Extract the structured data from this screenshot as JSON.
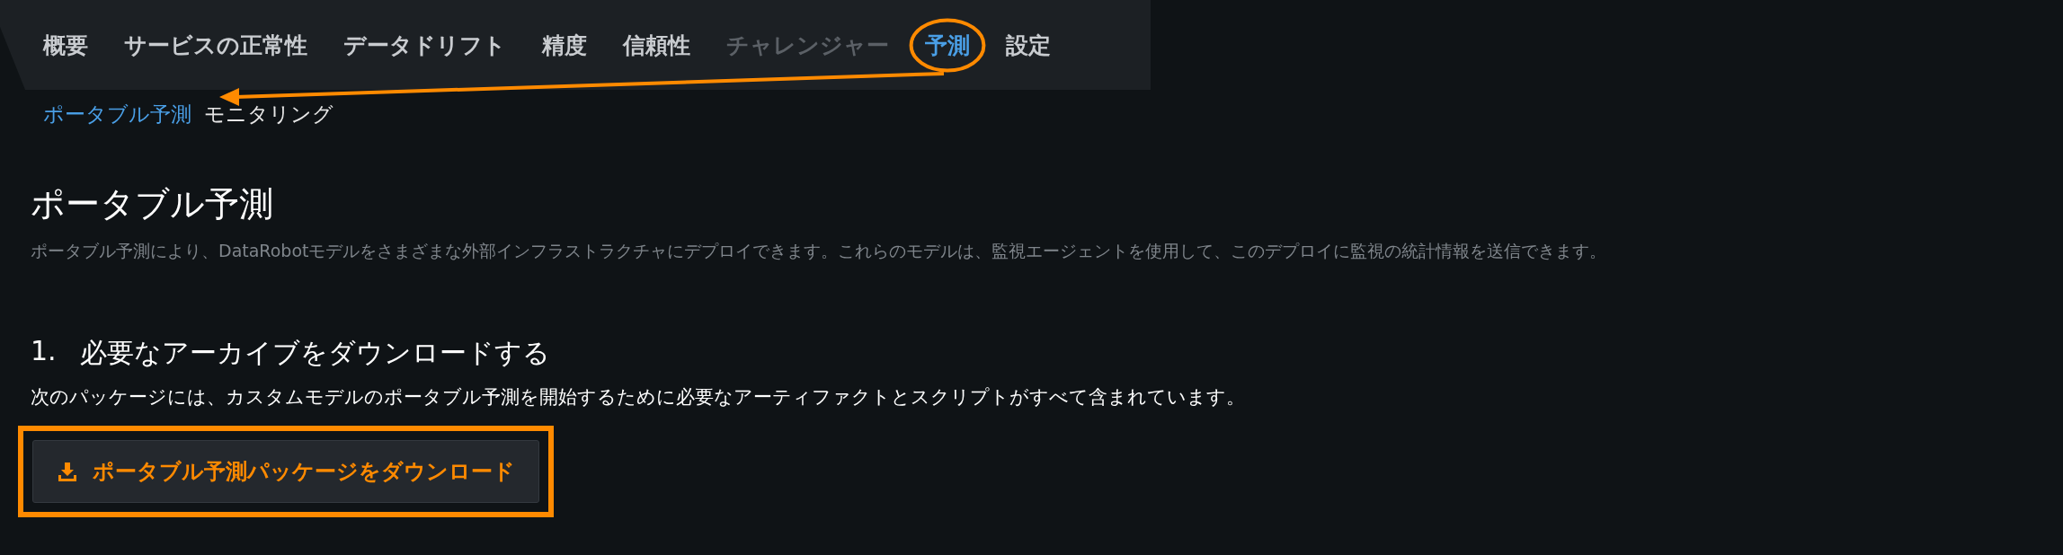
{
  "tabs": [
    {
      "label": "概要",
      "selected": false,
      "disabled": false
    },
    {
      "label": "サービスの正常性",
      "selected": false,
      "disabled": false
    },
    {
      "label": "データドリフト",
      "selected": false,
      "disabled": false
    },
    {
      "label": "精度",
      "selected": false,
      "disabled": false
    },
    {
      "label": "信頼性",
      "selected": false,
      "disabled": false
    },
    {
      "label": "チャレンジャー",
      "selected": false,
      "disabled": true
    },
    {
      "label": "予測",
      "selected": true,
      "disabled": false
    },
    {
      "label": "設定",
      "selected": false,
      "disabled": false
    }
  ],
  "subtabs": [
    {
      "label": "ポータブル予測",
      "selected": true
    },
    {
      "label": "モニタリング",
      "selected": false
    }
  ],
  "section": {
    "title": "ポータブル予測",
    "description": "ポータブル予測により、DataRobotモデルをさまざまな外部インフラストラクチャにデプロイできます。これらのモデルは、監視エージェントを使用して、このデプロイに監視の統計情報を送信できます。"
  },
  "step": {
    "number": "1.",
    "title": "必要なアーカイブをダウンロードする",
    "text": "次のパッケージには、カスタムモデルのポータブル予測を開始するために必要なアーティファクトとスクリプトがすべて含まれています。",
    "button": "ポータブル予測パッケージをダウンロード"
  }
}
